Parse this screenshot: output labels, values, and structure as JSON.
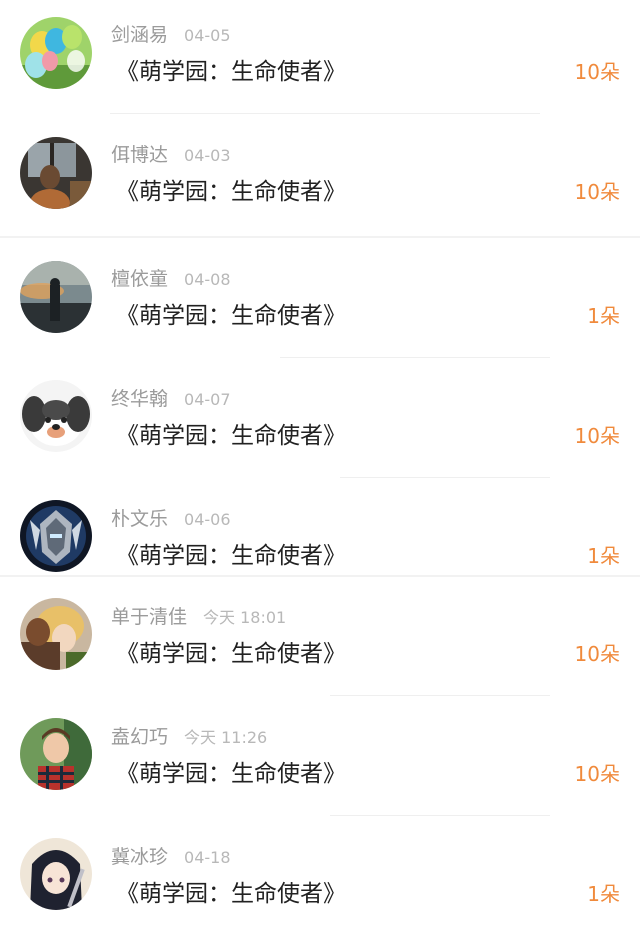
{
  "items": [
    {
      "name": "剑涵易",
      "date": "04-05",
      "title": "《萌学园：生命使者》",
      "count": "10朵",
      "avatar_icon": "balloons-avatar-icon"
    },
    {
      "name": "佴博达",
      "date": "04-03",
      "title": "《萌学园：生命使者》",
      "count": "10朵",
      "avatar_icon": "window-girl-avatar-icon"
    },
    {
      "name": "檀依童",
      "date": "04-08",
      "title": "《萌学园：生命使者》",
      "count": "1朵",
      "avatar_icon": "sunset-man-avatar-icon"
    },
    {
      "name": "终华翰",
      "date": "04-07",
      "title": "《萌学园：生命使者》",
      "count": "10朵",
      "avatar_icon": "cartoon-dog-avatar-icon"
    },
    {
      "name": "朴文乐",
      "date": "04-06",
      "title": "《萌学园：生命使者》",
      "count": "1朵",
      "avatar_icon": "armored-knight-avatar-icon"
    },
    {
      "name": "单于清佳",
      "date": "今天 18:01",
      "title": "《萌学园：生命使者》",
      "count": "10朵",
      "avatar_icon": "blonde-character-avatar-icon"
    },
    {
      "name": "盍幻巧",
      "date": "今天 11:26",
      "title": "《萌学园：生命使者》",
      "count": "10朵",
      "avatar_icon": "plaid-boy-avatar-icon"
    },
    {
      "name": "冀冰珍",
      "date": "04-18",
      "title": "《萌学园：生命使者》",
      "count": "1朵",
      "avatar_icon": "anime-girl-avatar-icon"
    }
  ],
  "colors": {
    "count_accent": "#f08a3c",
    "name_gray": "#9b9b9b",
    "title_dark": "#222222"
  }
}
